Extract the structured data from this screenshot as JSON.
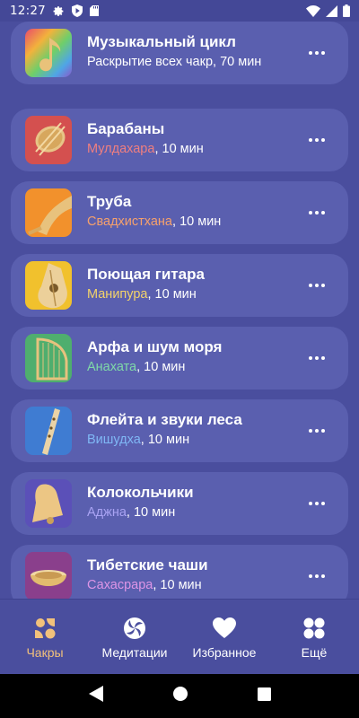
{
  "status_bar": {
    "time": "12:27",
    "left_icons": [
      "gear-icon",
      "shield-play-icon",
      "sd-card-icon"
    ],
    "right_icons": [
      "wifi-icon",
      "signal-icon",
      "battery-icon"
    ]
  },
  "colors": {
    "background": "#4a4e9e",
    "card": "#5a5faf",
    "active_nav": "#f2c17b"
  },
  "items": [
    {
      "title": "Музыкальный цикл",
      "chakra": "",
      "chakra_color": "#ffffff",
      "duration": "Раскрытие всех чакр, 70 мин",
      "icon": "music-note-icon"
    },
    {
      "title": "Барабаны",
      "chakra": "Мулдахара",
      "chakra_color": "#f07f7f",
      "duration": ", 10 мин",
      "icon": "drum-icon"
    },
    {
      "title": "Труба",
      "chakra": "Свадхистхана",
      "chakra_color": "#f6a16c",
      "duration": ", 10 мин",
      "icon": "trumpet-icon"
    },
    {
      "title": "Поющая гитара",
      "chakra": "Манипура",
      "chakra_color": "#f3d36a",
      "duration": ", 10 мин",
      "icon": "guitar-icon"
    },
    {
      "title": "Арфа и шум моря",
      "chakra": "Анахата",
      "chakra_color": "#7fd9a8",
      "duration": ", 10 мин",
      "icon": "harp-icon"
    },
    {
      "title": "Флейта и звуки леса",
      "chakra": "Вишудха",
      "chakra_color": "#7fb7f5",
      "duration": ", 10 мин",
      "icon": "flute-icon"
    },
    {
      "title": "Колокольчики",
      "chakra": "Аджна",
      "chakra_color": "#a9a3f3",
      "duration": ", 10 мин",
      "icon": "bell-icon"
    },
    {
      "title": "Тибетские чаши",
      "chakra": "Сахасрара",
      "chakra_color": "#dd95e6",
      "duration": ", 10 мин",
      "icon": "singing-bowl-icon"
    }
  ],
  "bottom_nav": [
    {
      "label": "Чакры",
      "icon": "chakras-icon",
      "active": true
    },
    {
      "label": "Медитации",
      "icon": "meditation-swirl-icon",
      "active": false
    },
    {
      "label": "Избранное",
      "icon": "heart-icon",
      "active": false
    },
    {
      "label": "Ещё",
      "icon": "more-grid-icon",
      "active": false
    }
  ],
  "system_nav": [
    "back-icon",
    "home-icon",
    "recents-icon"
  ]
}
